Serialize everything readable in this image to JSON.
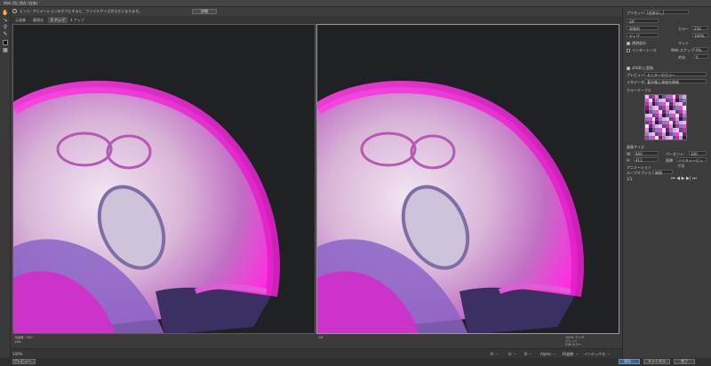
{
  "window": {
    "title": "Web 用に保存 (従来)"
  },
  "tip": {
    "text": "ヒント: アニメーションのオフにすると、ファイルサイズが小さくなります。",
    "button": "詳細"
  },
  "tabs": [
    {
      "label": "元画像"
    },
    {
      "label": "最適化"
    },
    {
      "label": "2 アップ"
    },
    {
      "label": "4 アップ"
    }
  ],
  "preview_left": {
    "caption": "元画像: \"GIF\"",
    "size": "14M"
  },
  "preview_right": {
    "caption": "GIF",
    "meta1": "100% ディザ",
    "meta2": "パレット",
    "meta3": "256 カラー"
  },
  "status": {
    "zoom": "100%",
    "r": "R: --",
    "g": "G: --",
    "b": "B: --",
    "alpha": "Alpha: --",
    "hex": "16進数: --",
    "index": "インデックス: --"
  },
  "panel": {
    "preset_label": "プリセット",
    "preset_value": "[名前なし]",
    "format": "GIF",
    "reduction": "知覚的",
    "colors_label": "カラー",
    "colors_value": "256",
    "dither_method": "ディザ",
    "dither_value": "100%",
    "transparency": "透明部分",
    "matte": "マット",
    "interlace": "インターレース",
    "web_snap": "Web スナップ",
    "web_snap_value": "0%",
    "lossy": "劣化",
    "lossy_value": "0",
    "convert_srgb": "sRGB に変換",
    "preview_label": "プレビュー",
    "preview_value": "モニターのカラー",
    "metadata_label": "メタデータ",
    "metadata_value": "著作権と連絡先情報",
    "color_table": "カラーテーブル",
    "image_size": "画像サイズ",
    "w_label": "W:",
    "w_value": "800",
    "h_label": "H:",
    "h_value": "412",
    "percent_label": "パーセント:",
    "percent_value": "100",
    "quality_label": "画質:",
    "quality_value": "バイキュービック法",
    "animation": "アニメーション",
    "loop_label": "ループオプション:",
    "loop_value": "無限",
    "frame_counter": "1/1"
  },
  "footer": {
    "preview_btn": "プレビュー...",
    "save": "保存...",
    "cancel": "キャンセル",
    "done": "完了"
  },
  "color_swatches": [
    "#f2b8ef",
    "#e34fd3",
    "#a93fa3",
    "#6b2a69",
    "#311a3a",
    "#c9b7d8",
    "#8f7ab0",
    "#5c4a82",
    "#efe1f2",
    "#d88fd6",
    "#b070c6",
    "#7d4fa0"
  ]
}
